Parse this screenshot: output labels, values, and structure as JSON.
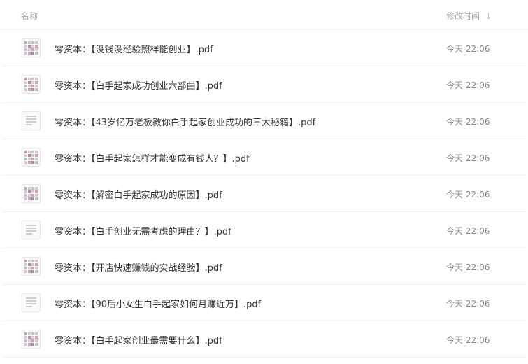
{
  "header": {
    "name_label": "名称",
    "time_label": "修改时间",
    "sort_icon": "arrow-down-icon",
    "sort_glyph": "↓"
  },
  "files": [
    {
      "name": "零资本：【没钱没经验照样能创业】.pdf",
      "time": "今天 22:06",
      "thumb": "grid"
    },
    {
      "name": "零资本：【白手起家成功创业六部曲】.pdf",
      "time": "今天 22:06",
      "thumb": "grid"
    },
    {
      "name": "零资本：【43岁亿万老板教你白手起家创业成功的三大秘籍】.pdf",
      "time": "今天 22:06",
      "thumb": "doc"
    },
    {
      "name": "零资本：【白手起家怎样才能变成有钱人？】.pdf",
      "time": "今天 22:06",
      "thumb": "grid"
    },
    {
      "name": "零资本：【解密白手起家成功的原因】.pdf",
      "time": "今天 22:06",
      "thumb": "grid"
    },
    {
      "name": "零资本：【白手创业无需考虑的理由？】.pdf",
      "time": "今天 22:06",
      "thumb": "doc"
    },
    {
      "name": "零资本：【开店快速赚钱的实战经验】.pdf",
      "time": "今天 22:06",
      "thumb": "grid"
    },
    {
      "name": "零资本：【90后小女生白手起家如何月赚近万】.pdf",
      "time": "今天 22:06",
      "thumb": "doc"
    },
    {
      "name": "零资本：【白手起家创业最需要什么】.pdf",
      "time": "今天 22:06",
      "thumb": "grid"
    }
  ]
}
